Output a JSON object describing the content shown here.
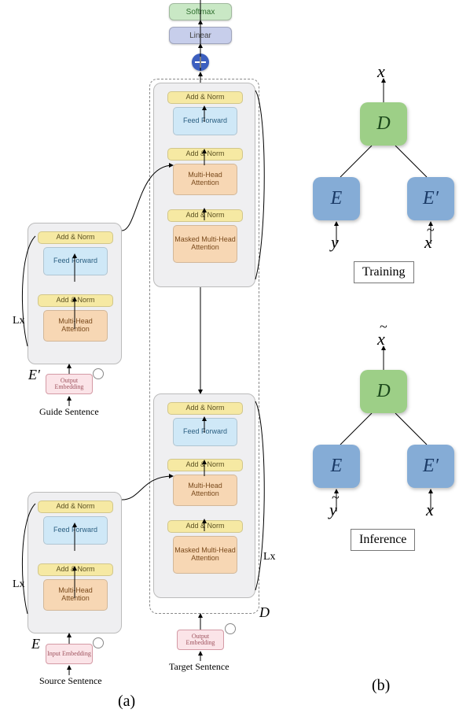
{
  "panel_labels": {
    "a": "(a)",
    "b": "(b)"
  },
  "head": {
    "softmax": "Softmax",
    "linear": "Linear"
  },
  "blocks": {
    "add_norm": "Add & Norm",
    "feed_forward": "Feed Forward",
    "mha": "Multi-Head Attention",
    "masked_mha": "Masked Multi-Head Attention"
  },
  "embeddings": {
    "input": "Input Embedding",
    "output": "Output Embedding"
  },
  "sentences": {
    "source": "Source Sentence",
    "guide": "Guide Sentence",
    "target": "Target Sentence"
  },
  "stage_multipliers": {
    "enc": "Lx",
    "encp": "Lx",
    "dec": "Lx"
  },
  "component_symbols": {
    "E": "E",
    "E_prime": "E′",
    "D": "D"
  },
  "panel_b": {
    "training": {
      "top_out": "x",
      "D": "D",
      "E": "E",
      "E_prime": "E′",
      "E_in": "y",
      "Ep_in": "x̃",
      "label": "Training"
    },
    "inference": {
      "top_out": "x̃",
      "D": "D",
      "E": "E",
      "E_prime": "E′",
      "E_in": "ỹ",
      "Ep_in": "x",
      "label": "Inference"
    }
  },
  "chart_data": {
    "type": "diagram",
    "description": "Neural machine-translation-style architecture. Left (a): transformer encoder E, guide encoder E′ and stacked decoder D with cross-attention to both encoders; each stack repeated L×. Outputs pass through Linear→Softmax. Right (b): two small trees showing data flow at Training (inputs y and x̃ produce x via E, E′, D) and Inference (inputs ỹ and x produce x̃).",
    "left_architecture": {
      "encoders": [
        "E",
        "E_prime"
      ],
      "decoder": "D",
      "stack_repeat": "L",
      "encoder_layers": [
        "Multi-Head Attention",
        "Add & Norm",
        "Feed Forward",
        "Add & Norm"
      ],
      "decoder_layers": [
        "Masked Multi-Head Attention",
        "Add & Norm",
        "Multi-Head Attention",
        "Add & Norm",
        "Feed Forward",
        "Add & Norm"
      ],
      "head": [
        "Linear",
        "Softmax"
      ],
      "inputs": {
        "E": "Source Sentence",
        "E_prime": "Guide Sentence",
        "D": "Target Sentence"
      }
    },
    "right_trees": [
      {
        "phase": "Training",
        "D_out": "x",
        "E_in": "y",
        "E_prime_in": "x_tilde"
      },
      {
        "phase": "Inference",
        "D_out": "x_tilde",
        "E_in": "y_tilde",
        "E_prime_in": "x"
      }
    ]
  }
}
